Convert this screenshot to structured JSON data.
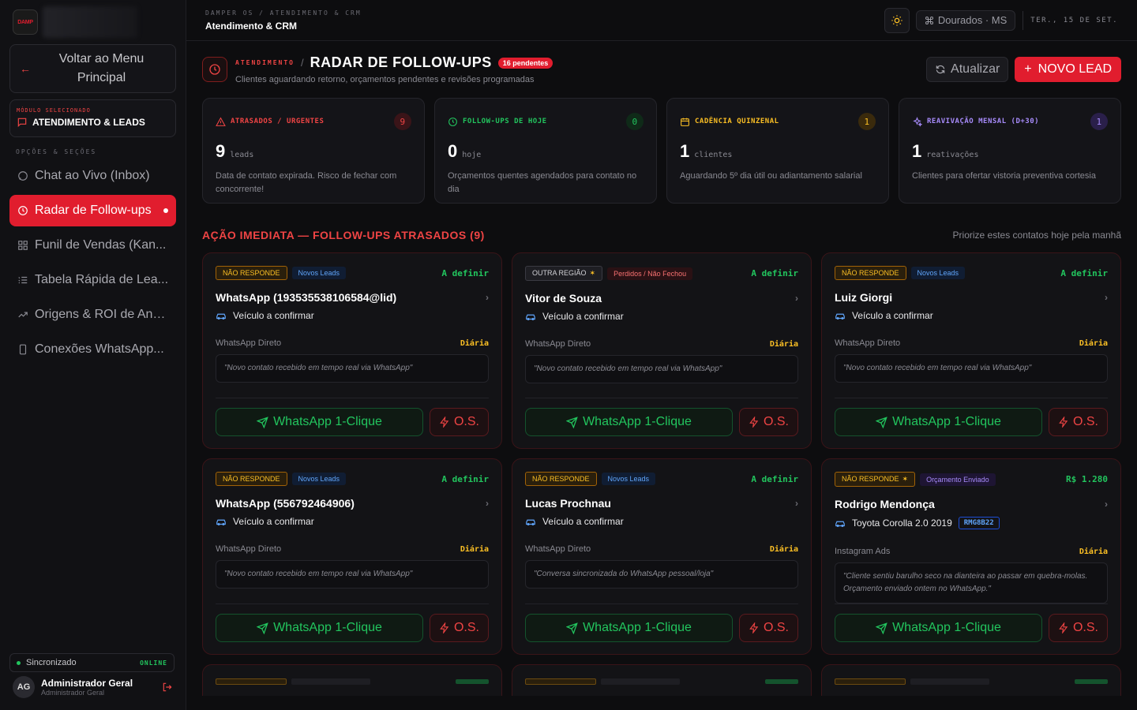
{
  "sidebar": {
    "logo_text": "DAMP",
    "back_label": "Voltar ao Menu Principal",
    "module_label": "MÓDULO SELECIONADO",
    "module_value": "ATENDIMENTO & LEADS",
    "section_title": "OPÇÕES & SEÇÕES",
    "items": [
      {
        "label": "Chat ao Vivo (Inbox)",
        "icon": "chat-icon"
      },
      {
        "label": "Radar de Follow-ups",
        "icon": "clock-icon",
        "active": true
      },
      {
        "label": "Funil de Vendas (Kan...",
        "icon": "grid-icon"
      },
      {
        "label": "Tabela Rápida de Lea...",
        "icon": "list-icon"
      },
      {
        "label": "Origens & ROI de Anú...",
        "icon": "trend-icon"
      },
      {
        "label": "Conexões WhatsApp...",
        "icon": "phone-icon"
      }
    ],
    "sync_label": "Sincronizado",
    "sync_status": "ONLINE",
    "user": {
      "initials": "AG",
      "name": "Administrador Geral",
      "role": "Administrador Geral"
    }
  },
  "topbar": {
    "breadcrumb": "DAMPER OS / ATENDIMENTO & CRM",
    "title": "Atendimento & CRM",
    "location": "Dourados · MS",
    "date": "TER., 15 DE SET."
  },
  "header": {
    "small_label": "ATENDIMENTO",
    "title": "RADAR DE FOLLOW-UPS",
    "badge": "16 pendentes",
    "subtitle": "Clientes aguardando retorno, orçamentos pendentes e revisões programadas",
    "refresh_label": "Atualizar",
    "new_lead_label": "NOVO LEAD"
  },
  "stats": [
    {
      "title": "ATRASADOS / URGENTES",
      "count": "9",
      "number": "9",
      "unit": "leads",
      "desc": "Data de contato expirada. Risco de fechar com concorrente!",
      "color": "#ef4444",
      "count_bg": "#3a1418"
    },
    {
      "title": "FOLLOW-UPS DE HOJE",
      "count": "0",
      "number": "0",
      "unit": "hoje",
      "desc": "Orçamentos quentes agendados para contato no dia",
      "color": "#22c55e",
      "count_bg": "#0f2a18"
    },
    {
      "title": "CADÊNCIA QUINZENAL",
      "count": "1",
      "number": "1",
      "unit": "clientes",
      "desc": "Aguardando 5º dia útil ou adiantamento salarial",
      "color": "#fbbf24",
      "count_bg": "#3a2a0c"
    },
    {
      "title": "REAVIVAÇÃO MENSAL (D+30)",
      "count": "1",
      "number": "1",
      "unit": "reativações",
      "desc": "Clientes para ofertar vistoria preventiva cortesia",
      "color": "#a78bfa",
      "count_bg": "#2a1f4a"
    }
  ],
  "section": {
    "title": "AÇÃO IMEDIATA — FOLLOW-UPS ATRASADOS (9)",
    "hint": "Priorize estes contatos hoje pela manhã"
  },
  "cards": [
    {
      "tag1": "NÃO RESPONDE",
      "tag1_star": "",
      "tag1_style": "or",
      "tag2": "Novos Leads",
      "tag2_style": "bl",
      "amount": "A definir",
      "name": "WhatsApp (193535538106584@lid)",
      "vehicle": "Veículo a confirmar",
      "plate": "",
      "source": "WhatsApp Direto",
      "freq": "Diária",
      "note": "\"Novo contato recebido em tempo real via WhatsApp\"",
      "wa_label": "WhatsApp 1-Clique",
      "os_label": "O.S."
    },
    {
      "tag1": "OUTRA REGIÃO",
      "tag1_star": "✶",
      "tag1_style": "gr",
      "tag2": "Perdidos / Não Fechou",
      "tag2_style": "rd",
      "amount": "A definir",
      "name": "Vitor de Souza",
      "vehicle": "Veículo a confirmar",
      "plate": "",
      "source": "WhatsApp Direto",
      "freq": "Diária",
      "note": "\"Novo contato recebido em tempo real via WhatsApp\"",
      "wa_label": "WhatsApp 1-Clique",
      "os_label": "O.S."
    },
    {
      "tag1": "NÃO RESPONDE",
      "tag1_star": "",
      "tag1_style": "or",
      "tag2": "Novos Leads",
      "tag2_style": "bl",
      "amount": "A definir",
      "name": "Luiz Giorgi",
      "vehicle": "Veículo a confirmar",
      "plate": "",
      "source": "WhatsApp Direto",
      "freq": "Diária",
      "note": "\"Novo contato recebido em tempo real via WhatsApp\"",
      "wa_label": "WhatsApp 1-Clique",
      "os_label": "O.S."
    },
    {
      "tag1": "NÃO RESPONDE",
      "tag1_star": "",
      "tag1_style": "or",
      "tag2": "Novos Leads",
      "tag2_style": "bl",
      "amount": "A definir",
      "name": "WhatsApp (556792464906)",
      "vehicle": "Veículo a confirmar",
      "plate": "",
      "source": "WhatsApp Direto",
      "freq": "Diária",
      "note": "\"Novo contato recebido em tempo real via WhatsApp\"",
      "wa_label": "WhatsApp 1-Clique",
      "os_label": "O.S."
    },
    {
      "tag1": "NÃO RESPONDE",
      "tag1_star": "",
      "tag1_style": "or",
      "tag2": "Novos Leads",
      "tag2_style": "bl",
      "amount": "A definir",
      "name": "Lucas Prochnau",
      "vehicle": "Veículo a confirmar",
      "plate": "",
      "source": "WhatsApp Direto",
      "freq": "Diária",
      "note": "\"Conversa sincronizada do WhatsApp pessoal/loja\"",
      "wa_label": "WhatsApp 1-Clique",
      "os_label": "O.S."
    },
    {
      "tag1": "NÃO RESPONDE",
      "tag1_star": "✶",
      "tag1_style": "or",
      "tag2": "Orçamento Enviado",
      "tag2_style": "pu",
      "amount": "R$ 1.280",
      "name": "Rodrigo Mendonça",
      "vehicle": "Toyota Corolla 2.0 2019",
      "plate": "RMG8B22",
      "source": "Instagram Ads",
      "freq": "Diária",
      "note": "\"Cliente sentiu barulho seco na dianteira ao passar em quebra-molas. Orçamento enviado ontem no WhatsApp.\"",
      "wa_label": "WhatsApp 1-Clique",
      "os_label": "O.S."
    }
  ],
  "colors": {
    "accent": "#e11d2e",
    "success": "#22c55e",
    "warning": "#fbbf24"
  }
}
